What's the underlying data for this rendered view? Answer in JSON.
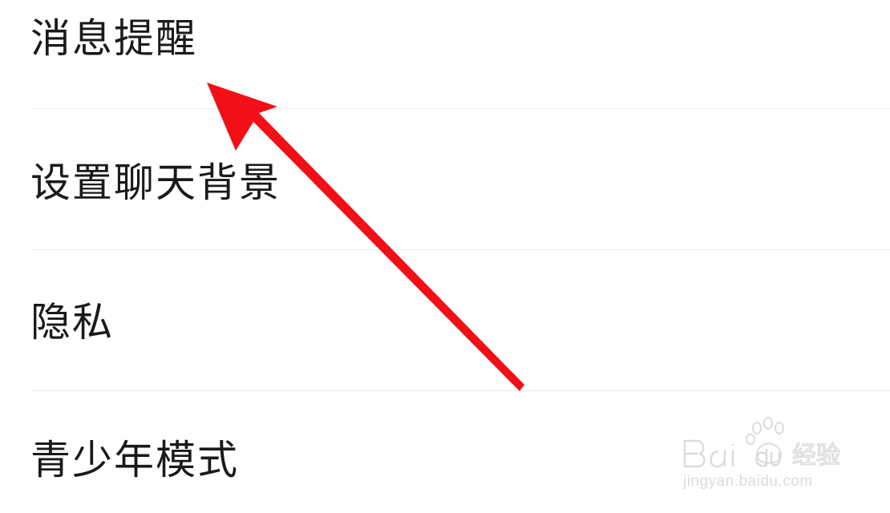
{
  "settings": {
    "items": [
      {
        "label": "消息提醒"
      },
      {
        "label": "设置聊天背景"
      },
      {
        "label": "隐私"
      },
      {
        "label": "青少年模式"
      }
    ]
  },
  "annotation": {
    "arrow_color": "#f20f16",
    "points_to": "消息提醒"
  },
  "watermark": {
    "logo_text": "Baidu经验",
    "url": "jingyan.baidu.com",
    "color": "#dcdcdc"
  }
}
